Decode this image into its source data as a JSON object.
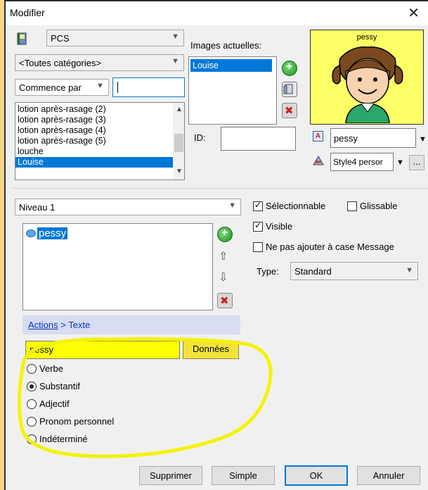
{
  "window": {
    "title": "Modifier",
    "close_glyph": "✕"
  },
  "symbol_set": {
    "value": "PCS"
  },
  "category": {
    "value": "<Toutes catégories>"
  },
  "search": {
    "mode": "Commence par",
    "query": ""
  },
  "symbol_list": {
    "items": [
      "lotion après-rasage (2)",
      "lotion après-rasage (3)",
      "lotion après-rasage (4)",
      "lotion après-rasage (5)",
      "louche",
      "Louise"
    ],
    "selected_index": 5
  },
  "current_images": {
    "label": "Images actuelles:",
    "items": [
      "Louise"
    ]
  },
  "preview": {
    "caption": "pessy",
    "bg_color": "#ffff66"
  },
  "id_field": {
    "label": "ID:",
    "value": ""
  },
  "label_text": {
    "value": "pessy"
  },
  "style": {
    "value": "Style4 persor",
    "more": "..."
  },
  "level": {
    "value": "Niveau 1"
  },
  "message_list": {
    "items": [
      "pessy"
    ]
  },
  "breadcrumb": {
    "link": "Actions",
    "sep": " > ",
    "current": "Texte"
  },
  "text_input": {
    "value": "pessy"
  },
  "data_button": {
    "label": "Données"
  },
  "word_types": [
    {
      "label": "Verbe",
      "checked": false
    },
    {
      "label": "Substantif",
      "checked": true
    },
    {
      "label": "Adjectif",
      "checked": false
    },
    {
      "label": "Pronom personnel",
      "checked": false
    },
    {
      "label": "Indéterminé",
      "checked": false
    }
  ],
  "options": {
    "selectable": "Sélectionnable",
    "draggable": "Glissable",
    "visible": "Visible",
    "no_message": "Ne pas ajouter à case Message"
  },
  "type_field": {
    "label": "Type:",
    "value": "Standard"
  },
  "footer": {
    "delete": "Supprimer",
    "simple": "Simple",
    "ok": "OK",
    "cancel": "Annuler"
  },
  "highlight_color": "#ffff00"
}
